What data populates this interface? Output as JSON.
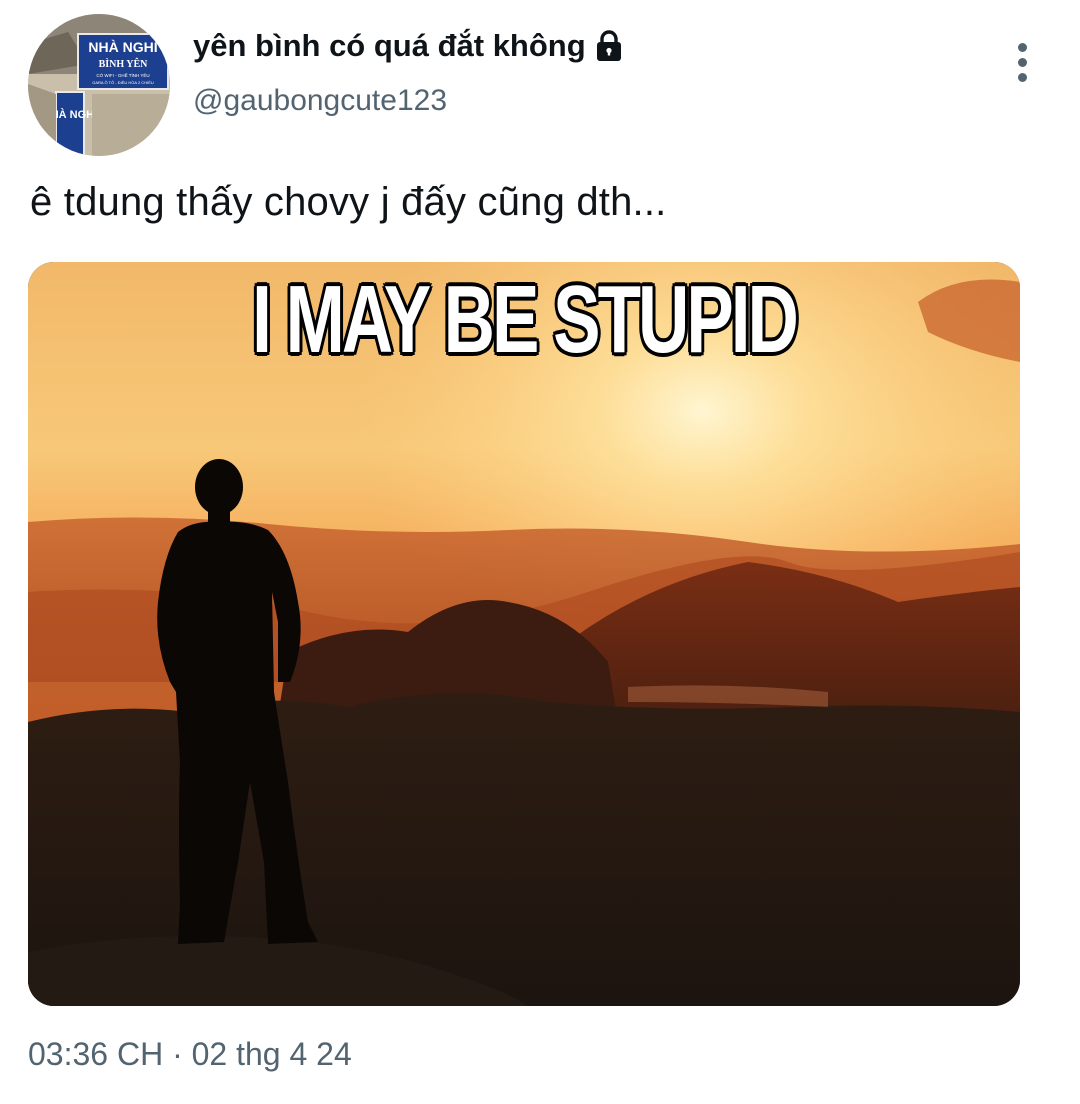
{
  "tweet": {
    "display_name": "yên bình có quá đắt không",
    "handle": "@gaubongcute123",
    "text": "ê tdung thấy chovy j đấy cũng dth...",
    "timestamp": "03:36 CH · 02 thg 4 24",
    "protected_icon": "lock-icon",
    "more_icon": "more-vertical-icon"
  },
  "avatar": {
    "sign_line_1": "NHÀ NGHỈ",
    "sign_line_2": "BÌNH YÊN",
    "sign_line_3": "CÓ WIFI - GHẾ TÌNH YÊU",
    "sign_line_4": "GARA Ô TÔ - ĐIỀU HÒA 2 CHIỀU",
    "sign_vertical": "NHÀ NGHỈ"
  },
  "media": {
    "caption": "I MAY BE STUPID"
  },
  "colors": {
    "text_primary": "#0f1419",
    "text_secondary": "#536471",
    "sign_blue": "#1d3f8f"
  }
}
